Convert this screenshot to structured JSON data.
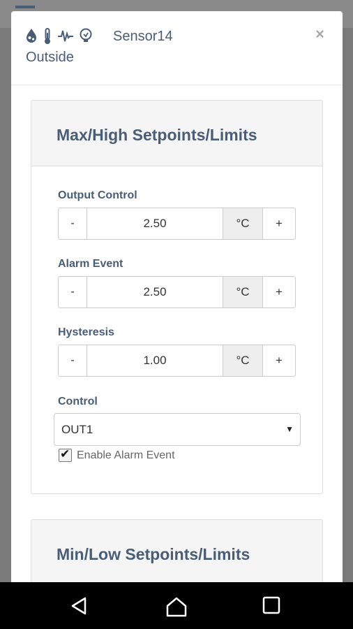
{
  "sensor": {
    "name": "Sensor14",
    "location": "Outside",
    "status_icons": [
      "water-drop-icon",
      "thermometer-icon",
      "pulse-icon",
      "bulb-icon"
    ]
  },
  "close_label": "×",
  "max_section": {
    "title": "Max/High Setpoints/Limits",
    "output_control": {
      "label": "Output Control",
      "minus": "-",
      "value": "2.50",
      "unit": "°C",
      "plus": "+"
    },
    "alarm_event": {
      "label": "Alarm Event",
      "minus": "-",
      "value": "2.50",
      "unit": "°C",
      "plus": "+"
    },
    "hysteresis": {
      "label": "Hysteresis",
      "minus": "-",
      "value": "1.00",
      "unit": "°C",
      "plus": "+"
    },
    "control": {
      "label": "Control",
      "selected": "OUT1"
    },
    "enable_alarm": {
      "label": "Enable Alarm Event",
      "checked": true
    }
  },
  "min_section": {
    "title": "Min/Low Setpoints/Limits"
  },
  "navbar": {
    "buttons": [
      "back-icon",
      "home-icon",
      "recents-icon"
    ]
  },
  "colors": {
    "accent_text": "#4a5d76",
    "unit_bg": "#eeeeee",
    "card_header_bg": "#f5f5f5"
  }
}
